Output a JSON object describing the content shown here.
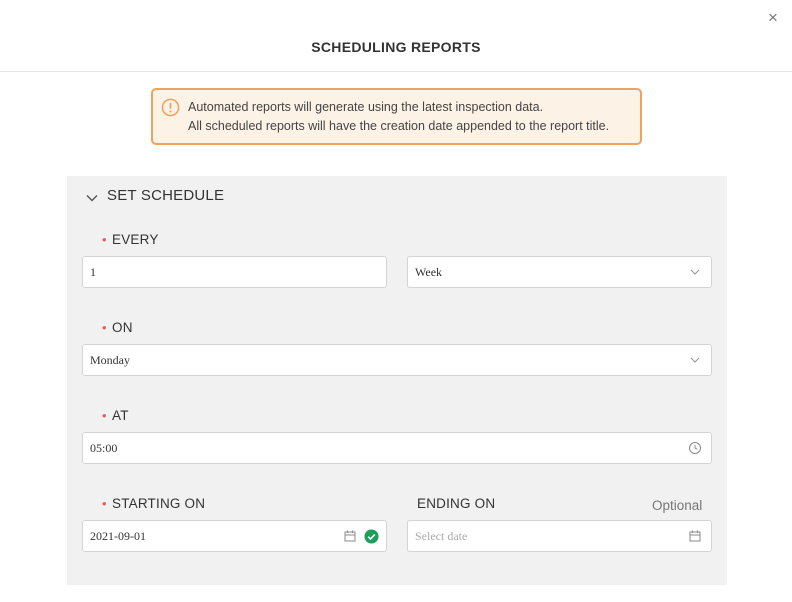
{
  "modal": {
    "title": "SCHEDULING REPORTS",
    "close_icon": "×"
  },
  "alert": {
    "icon": "info-circle-icon",
    "line1": "Automated reports will generate using the latest inspection data.",
    "line2": "All scheduled reports will have the creation date appended to the report title."
  },
  "schedule": {
    "title": "SET SCHEDULE",
    "every": {
      "label": "EVERY",
      "value": "1",
      "unit": "Week"
    },
    "on": {
      "label": "ON",
      "value": "Monday"
    },
    "at": {
      "label": "AT",
      "value": "05:00"
    },
    "starting_on": {
      "label": "STARTING ON",
      "value": "2021-09-01"
    },
    "ending_on": {
      "label": "ENDING ON",
      "optional": "Optional",
      "placeholder": "Select date"
    }
  },
  "colors": {
    "alert_border": "#f0a25c",
    "alert_bg": "#fdf2e6",
    "required_marker": "#e8604c",
    "valid_check": "#1e9e5a",
    "panel_bg": "#f1f1f1"
  }
}
